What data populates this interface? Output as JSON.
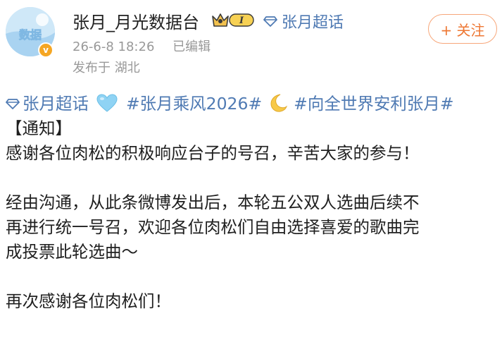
{
  "post": {
    "author_name": "张月_月光数据台",
    "level_badge_text": "I",
    "supertopic_link": "张月超话",
    "date": "26-6-8 18:26",
    "edited": "已编辑",
    "location": "发布于 湖北",
    "follow_label": "+ 关注",
    "avatar_text": "数据"
  },
  "content": {
    "tag_supertopic": "张月超话",
    "tag_chengfeng": "#张月乘风2026#",
    "tag_anli": "#向全世界安利张月#",
    "notice": "【通知】",
    "line1": "感谢各位肉松的积极响应台子的号召，辛苦大家的参与！",
    "para2_line1": "经由沟通，从此条微博发出后，本轮五公双人选曲后续不",
    "para2_line2": "再进行统一号召，欢迎各位肉松们自由选择喜爱的歌曲完",
    "para2_line3": "成投票此轮选曲～",
    "closing": "再次感谢各位肉松们！"
  },
  "icons": {
    "verified": "verified-v-icon",
    "crown": "crown-icon",
    "diamond": "supertopic-diamond-icon",
    "heart": "light-blue-heart-emoji",
    "moon": "crescent-moon-emoji"
  },
  "colors": {
    "link": "#4f7ab3",
    "follow": "#ee7733",
    "meta": "#999999",
    "verified": "#f5a623"
  }
}
